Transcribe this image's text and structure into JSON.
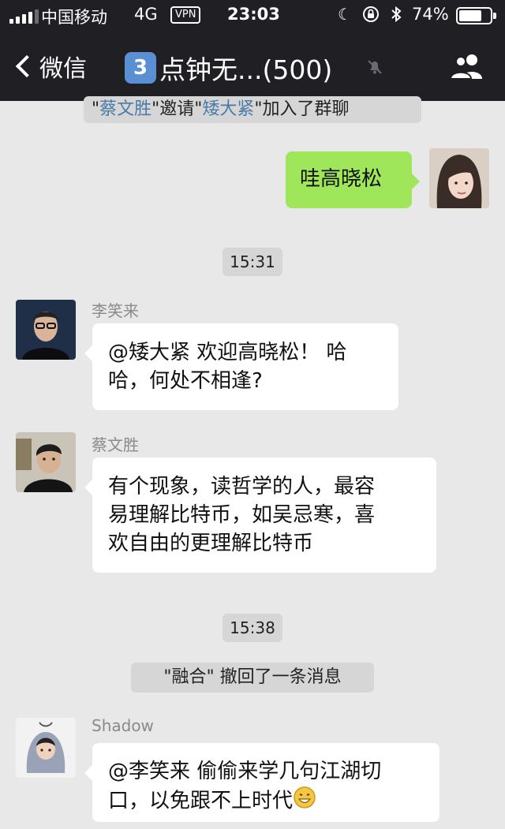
{
  "status_bar": {
    "carrier": "中国移动",
    "network": "4G",
    "vpn": "VPN",
    "time": "23:03",
    "battery": "74%",
    "battery_level": 0.74,
    "signal_bars_filled": 4,
    "icons": [
      "moon-icon",
      "orientation-lock-icon",
      "bluetooth-icon"
    ]
  },
  "nav": {
    "back_label": "微信",
    "badge": "3",
    "title": "点钟无...(500)",
    "muted_icon": "mute-bell-icon",
    "right_icon": "group-members-icon"
  },
  "messages": {
    "invite": {
      "a": "\"",
      "inviter": "蔡文胜",
      "b": "\"邀请\"",
      "invitee": "矮大紧",
      "c": "\"加入了群聊"
    },
    "self_msg": {
      "text": "哇高晓松"
    },
    "time1": "15:31",
    "li": {
      "sender": "李笑来",
      "lines": [
        "@矮大紧 欢迎高晓松！ 哈",
        "哈，何处不相逢?"
      ]
    },
    "cai": {
      "sender": "蔡文胜",
      "lines": [
        "有个现象，读哲学的人，最容",
        "易理解比特币，如吴忌寒，喜",
        "欢自由的更理解比特币"
      ]
    },
    "time2": "15:38",
    "recall": {
      "text": "\"融合\" 撤回了一条消息"
    },
    "shadow": {
      "sender": "Shadow",
      "line1": "@李笑来 偷偷来学几句江湖切",
      "line2": "口，以免跟不上时代",
      "emoji": "grin-emoji"
    }
  },
  "colors": {
    "header_bg": "#1f1f24",
    "chat_bg": "#e8e8e8",
    "my_bubble": "#9fe65a",
    "their_bubble": "#ffffff",
    "name_link": "#4a7ba8"
  }
}
